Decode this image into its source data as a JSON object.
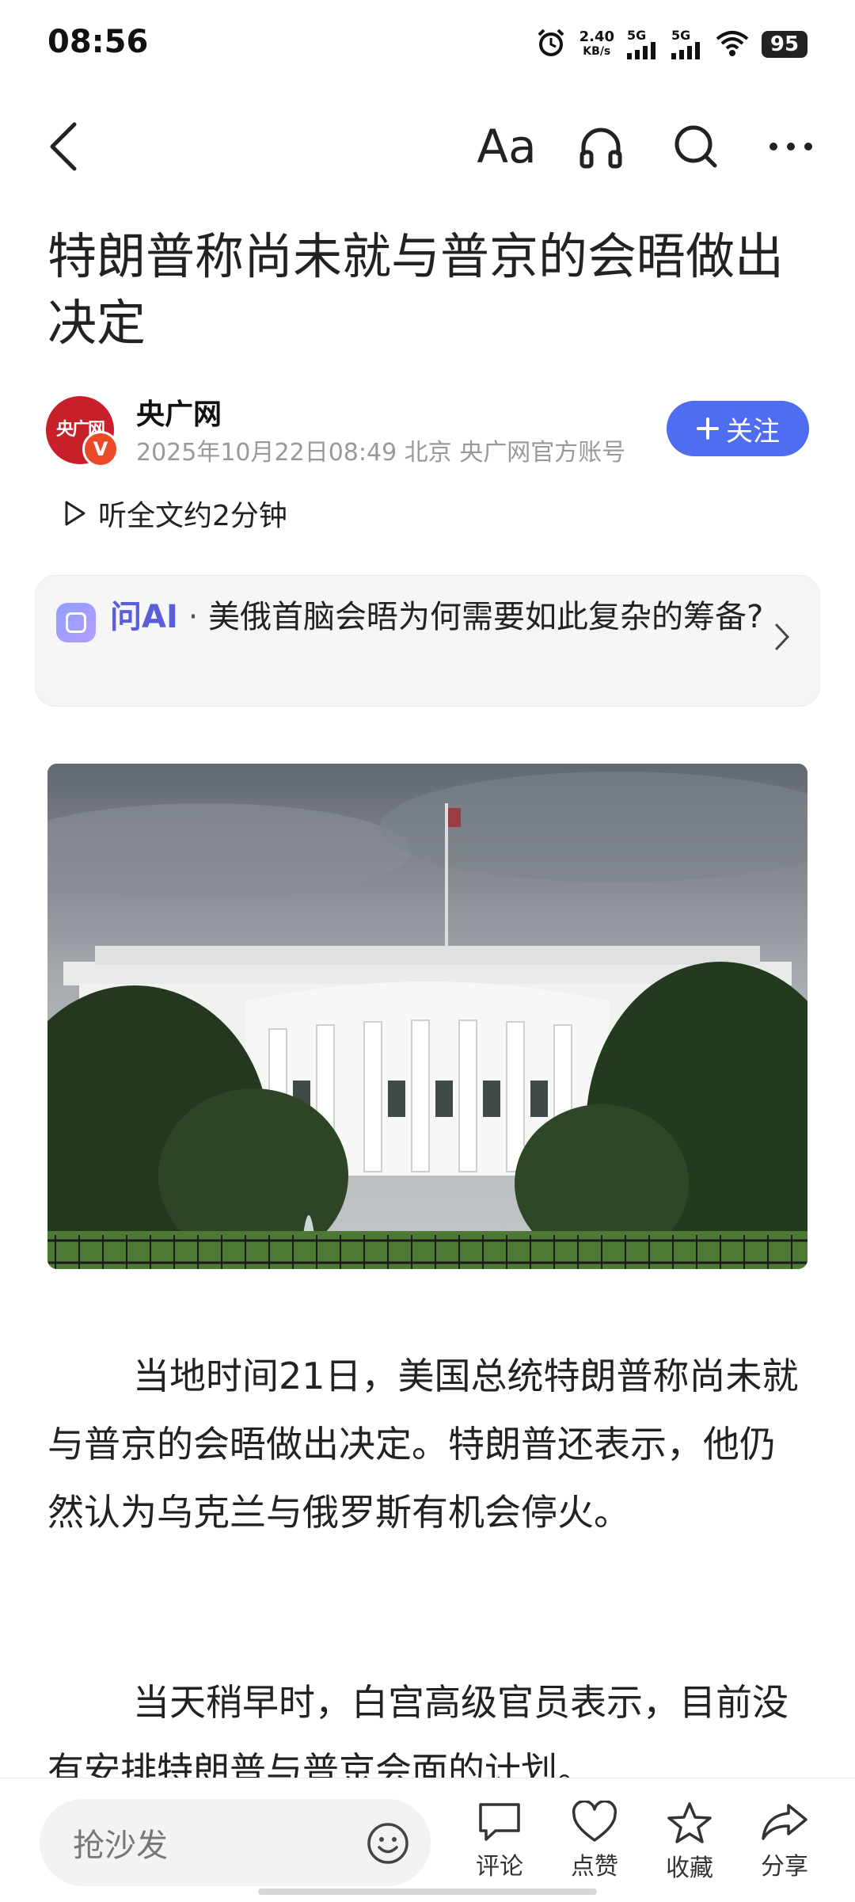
{
  "status": {
    "time": "08:56",
    "net_speed_value": "2.40",
    "net_speed_unit": "KB/s",
    "sim1": "5G",
    "sim2": "5G",
    "battery": "95"
  },
  "toolbar": {
    "font_label": "Aa"
  },
  "article": {
    "title": "特朗普称尚未就与普京的会晤做出决定",
    "author_name": "央广网",
    "author_meta": "2025年10月22日08:49 北京 央广网官方账号",
    "avatar_text": "央广网",
    "avatar_badge": "V",
    "follow_label": "关注",
    "listen_label": "听全文约2分钟",
    "ai_label": "问AI",
    "ai_question": "美俄首脑会晤为何需要如此复杂的筹备?",
    "paragraphs": [
      "当地时间21日，美国总统特朗普称尚未就与普京的会晤做出决定。特朗普还表示，他仍然认为乌克兰与俄罗斯有机会停火。",
      "当天稍早时，白宫高级官员表示，目前没有安排特朗普与普京会面的计划。"
    ]
  },
  "bottom_bar": {
    "comment_placeholder": "抢沙发",
    "actions": [
      "评论",
      "点赞",
      "收藏",
      "分享"
    ]
  },
  "colors": {
    "accent": "#4f6df0",
    "ai_purple": "#5a5ed8",
    "brand_red": "#c8202a"
  }
}
